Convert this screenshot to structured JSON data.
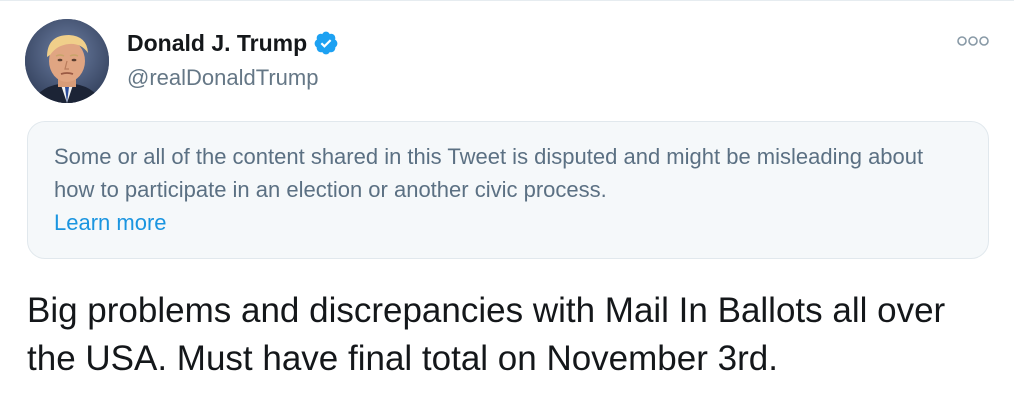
{
  "tweet": {
    "author": {
      "display_name": "Donald J. Trump",
      "handle": "@realDonaldTrump",
      "verified": true,
      "avatar_icon": "avatar-photo-icon"
    },
    "more_icon": "more-options-icon",
    "notice": {
      "text": "Some or all of the content shared in this Tweet is disputed and might be misleading about how to participate in an election or another civic process.",
      "link_label": "Learn more"
    },
    "body_text": "Big problems and discrepancies with Mail In Ballots all over the USA. Must have final total on November 3rd."
  },
  "colors": {
    "verified_blue": "#1da1f2",
    "link_blue": "#1b95e0",
    "notice_bg": "#f5f8fa",
    "secondary_text": "#657786"
  }
}
